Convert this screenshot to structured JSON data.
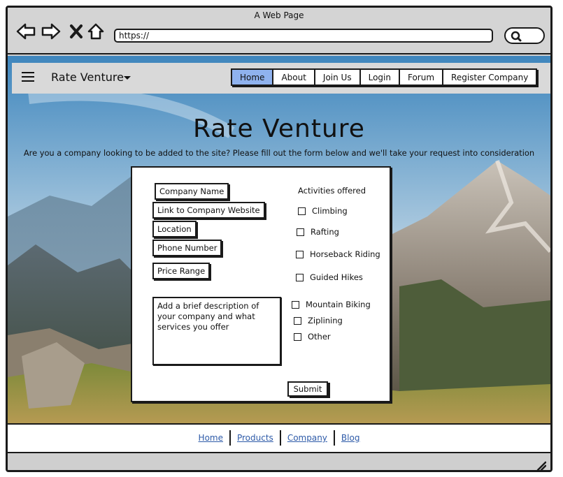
{
  "browser": {
    "window_title": "A Web Page",
    "url": "https://",
    "icons": [
      "back-arrow-icon",
      "forward-arrow-icon",
      "close-x-icon",
      "home-icon",
      "search-icon"
    ]
  },
  "navbar": {
    "brand": "Rate Venture",
    "tabs": [
      "Home",
      "About",
      "Join Us",
      "Login",
      "Forum",
      "Register Company"
    ],
    "active_tab": "Home"
  },
  "hero": {
    "title": "Rate Venture",
    "subtitle": "Are you a company looking to be added to the site? Please fill out the form below and we'll take your request into consideration"
  },
  "form": {
    "fields": [
      "Company Name",
      "Link to Company Website",
      "Location",
      "Phone Number",
      "Price Range"
    ],
    "description_placeholder": "Add a brief description of your company and what services you offer",
    "activities_title": "Activities offered",
    "activities": [
      "Climbing",
      "Rafting",
      "Horseback Riding",
      "Guided Hikes",
      "Mountain Biking",
      "Ziplining",
      "Other"
    ],
    "submit_label": "Submit"
  },
  "footer": {
    "links": [
      "Home",
      "Products",
      "Company",
      "Blog"
    ]
  },
  "colors": {
    "active_tab": "#8fb2ee",
    "link": "#2d5aa8",
    "nav_bg": "#d9d9d9"
  }
}
